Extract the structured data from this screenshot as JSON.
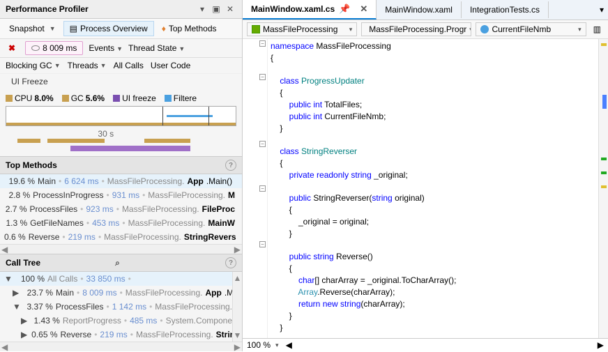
{
  "profiler": {
    "title": "Performance Profiler",
    "snapshot_label": "Snapshot",
    "process_overview_label": "Process Overview",
    "top_methods_btn": "Top Methods",
    "total_time": "8 009 ms",
    "events_label": "Events",
    "thread_state_label": "Thread State",
    "blocking_gc_label": "Blocking GC",
    "threads_label": "Threads",
    "all_calls_label": "All Calls",
    "user_code_label": "User Code",
    "status": "UI Freeze",
    "legend": {
      "cpu": "CPU",
      "cpu_val": "8.0%",
      "gc": "GC",
      "gc_val": "5.6%",
      "ui": "UI freeze",
      "filtered": "Filtere"
    },
    "timescale": "30 s"
  },
  "top_methods": {
    "title": "Top Methods",
    "rows": [
      {
        "pct": "19.6 %",
        "name": "Main",
        "time": "6 624 ms",
        "ns": "MassFileProcessing.",
        "cls": "App",
        "method": ".Main()"
      },
      {
        "pct": "2.8 %",
        "name": "ProcessInProgress",
        "time": "931 ms",
        "ns": "MassFileProcessing.",
        "cls": "M",
        "method": ""
      },
      {
        "pct": "2.7 %",
        "name": "ProcessFiles",
        "time": "923 ms",
        "ns": "MassFileProcessing.",
        "cls": "FileProc",
        "method": ""
      },
      {
        "pct": "1.3 %",
        "name": "GetFileNames",
        "time": "453 ms",
        "ns": "MassFileProcessing.",
        "cls": "MainW",
        "method": ""
      },
      {
        "pct": "0.6 %",
        "name": "Reverse",
        "time": "219 ms",
        "ns": "MassFileProcessing.",
        "cls": "StringRevers",
        "method": ""
      }
    ]
  },
  "call_tree": {
    "title": "Call Tree",
    "rows": [
      {
        "pct": "100 %",
        "name": "All Calls",
        "time": "33 850 ms",
        "ns": "",
        "cls": "",
        "method": "",
        "depth": 0,
        "icon": "▼",
        "gray": true
      },
      {
        "pct": "23.7 %",
        "name": "Main",
        "time": "8 009 ms",
        "ns": "MassFileProcessing.",
        "cls": "App",
        "method": ".M",
        "depth": 1,
        "icon": "▶"
      },
      {
        "pct": "3.37 %",
        "name": "ProcessFiles",
        "time": "1 142 ms",
        "ns": "MassFileProcessing.",
        "cls": "",
        "method": "",
        "depth": 1,
        "icon": "▼"
      },
      {
        "pct": "1.43 %",
        "name": "ReportProgress",
        "time": "485 ms",
        "ns": "System.Compone",
        "cls": "",
        "method": "",
        "depth": 2,
        "icon": "▶",
        "gray": true
      },
      {
        "pct": "0.65 %",
        "name": "Reverse",
        "time": "219 ms",
        "ns": "MassFileProcessing.",
        "cls": "Strin",
        "method": "",
        "depth": 2,
        "icon": "▶"
      }
    ]
  },
  "editor": {
    "tabs": [
      {
        "label": "MainWindow.xaml.cs",
        "active": true
      },
      {
        "label": "MainWindow.xaml",
        "active": false
      },
      {
        "label": "IntegrationTests.cs",
        "active": false
      }
    ],
    "context": {
      "namespace": "MassFileProcessing",
      "class": "MassFileProcessing.Progr",
      "member": "CurrentFileNmb"
    },
    "zoom": "100 %"
  },
  "code": {
    "l1a": "namespace",
    "l1b": " MassFileProcessing",
    "l2": "{",
    "l4a": "    class ",
    "l4b": "ProgressUpdater",
    "l5": "    {",
    "l6a": "        public",
    "l6b": " int",
    "l6c": " TotalFiles;",
    "l7a": "        public",
    "l7b": " int",
    "l7c": " CurrentFileNmb;",
    "l8": "    }",
    "l10a": "    class ",
    "l10b": "StringReverser",
    "l11": "    {",
    "l12a": "        private",
    "l12b": " readonly",
    "l12c": " string",
    "l12d": " _original;",
    "l14a": "        public",
    "l14b": " StringReverser(",
    "l14c": "string",
    "l14d": " original)",
    "l15": "        {",
    "l16": "            _original = original;",
    "l17": "        }",
    "l19a": "        public",
    "l19b": " string",
    "l19c": " Reverse()",
    "l20": "        {",
    "l21a": "            char",
    "l21b": "[] charArray = _original.ToCharArray();",
    "l22a": "            Array",
    "l22b": ".Reverse(charArray);",
    "l23a": "            return",
    "l23b": " new",
    "l23c": " string",
    "l23d": "(charArray);",
    "l24": "        }",
    "l25": "    }"
  }
}
